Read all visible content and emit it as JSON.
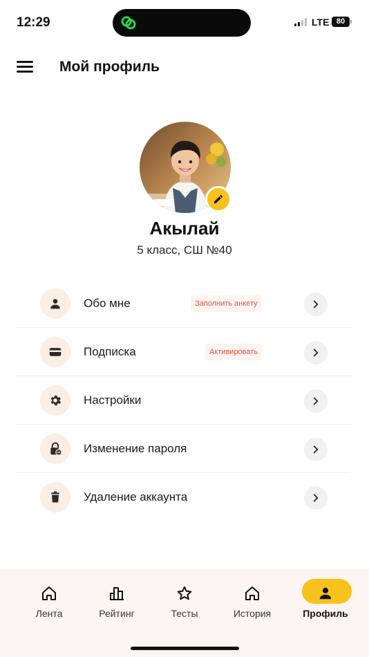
{
  "status_bar": {
    "time": "12:29",
    "network": "LTE",
    "battery": "80"
  },
  "header": {
    "title": "Мой профиль",
    "menu_icon": "hamburger-icon"
  },
  "profile": {
    "name": "Акылай",
    "subtitle": "5 класс, СШ №40",
    "edit_icon": "pencil-icon"
  },
  "menu": {
    "items": [
      {
        "label": "Обо мне",
        "badge": "Заполнить анкету",
        "icon": "person-icon"
      },
      {
        "label": "Подписка",
        "badge": "Активировать",
        "icon": "card-icon"
      },
      {
        "label": "Настройки",
        "badge": "",
        "icon": "gear-icon"
      },
      {
        "label": "Изменение пароля",
        "badge": "",
        "icon": "lock-icon"
      },
      {
        "label": "Удаление аккаунта",
        "badge": "",
        "icon": "trash-icon"
      }
    ]
  },
  "bottom_nav": {
    "items": [
      {
        "label": "Лента",
        "icon": "home-icon"
      },
      {
        "label": "Рейтинг",
        "icon": "bar-chart-icon"
      },
      {
        "label": "Тесты",
        "icon": "star-icon"
      },
      {
        "label": "История",
        "icon": "home-icon"
      },
      {
        "label": "Профиль",
        "icon": "person-icon"
      }
    ],
    "active": "Профиль"
  },
  "colors": {
    "accent": "#f7c21c",
    "badge_text": "#e0573c",
    "icon_bg": "#fbeee3",
    "nav_bg": "#fdf5f2"
  }
}
